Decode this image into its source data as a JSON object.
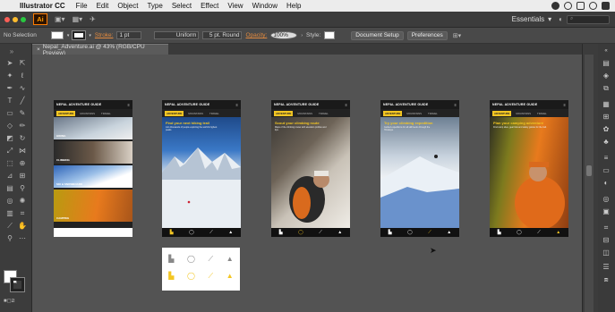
{
  "menubar": {
    "app_name": "Illustrator CC",
    "items": [
      "File",
      "Edit",
      "Object",
      "Type",
      "Select",
      "Effect",
      "View",
      "Window",
      "Help"
    ]
  },
  "appbar": {
    "logo": "Ai",
    "workspace": "Essentials",
    "workspace_chevron": "▾"
  },
  "control": {
    "selection_status": "No Selection",
    "stroke_label": "Stroke:",
    "stroke_weight": "1 pt",
    "profile": "Uniform",
    "brush": "5 pt. Round",
    "opacity_label": "Opacity:",
    "opacity_value": "100%",
    "style_label": "Style:",
    "doc_setup": "Document Setup",
    "preferences": "Preferences"
  },
  "document": {
    "tab_title": "Nepal_Adventure.ai @ 43% (RGB/CPU Preview)"
  },
  "artboards": [
    {
      "header": "NEPAL ADVENTURE GUIDE",
      "tabs": [
        "ADVENTURE",
        "MOUNTAINS",
        "TRAVEL"
      ],
      "strips": [
        "HIKING",
        "CLIMBING",
        "SKI & SNOWBOARD",
        "CAMPING"
      ]
    },
    {
      "header": "NEPAL ADVENTURE GUIDE",
      "tabs": [
        "ADVENTURE",
        "MOUNTAINS",
        "TRAVEL"
      ],
      "title": "Find your next hiking trail",
      "body": "Join thousands of people exploring the world's highest peaks."
    },
    {
      "header": "NEPAL ADVENTURE GUIDE",
      "tabs": [
        "ADVENTURE",
        "MOUNTAINS",
        "TRAVEL"
      ],
      "title": "Scout your climbing route",
      "body": "Maps of the climbing routes with elevation profiles and tips."
    },
    {
      "header": "NEPAL ADVENTURE GUIDE",
      "tabs": [
        "ADVENTURE",
        "MOUNTAINS",
        "TRAVEL"
      ],
      "title": "Try your climbing expedition",
      "body": "Guided expeditions for all skill levels through the Himalaya."
    },
    {
      "header": "NEPAL ADVENTURE GUIDE",
      "tabs": [
        "ADVENTURE",
        "MOUNTAINS",
        "TRAVEL"
      ],
      "title": "Plan your camping adventure",
      "body": "Find camp sites, gear lists and safety guides for the trail."
    }
  ],
  "colors": {
    "accent": "#f3c623",
    "orange": "#e8701a"
  }
}
